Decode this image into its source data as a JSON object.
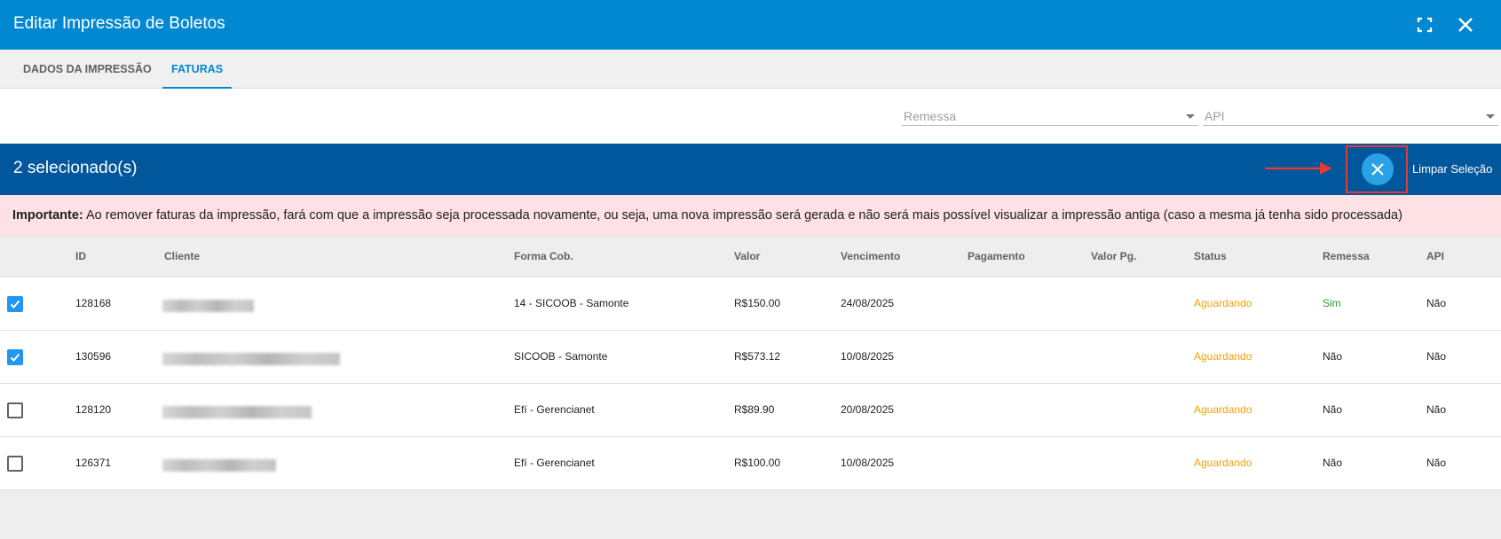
{
  "dialog": {
    "title": "Editar Impressão de Boletos"
  },
  "titlebar_icons": {
    "fullscreen": "fullscreen-icon",
    "close": "close-icon"
  },
  "tabs": [
    {
      "label": "DADOS DA IMPRESSÃO",
      "active": false
    },
    {
      "label": "FATURAS",
      "active": true
    }
  ],
  "filters": {
    "remessa_placeholder": "Remessa",
    "api_placeholder": "API"
  },
  "selection": {
    "count_label": "2 selecionado(s)",
    "clear_label": "Limpar Seleção"
  },
  "warning": {
    "strong": "Importante:",
    "text": " Ao remover faturas da impressão, fará com que a impressão seja processada novamente, ou seja, uma nova impressão será gerada e não será mais possível visualizar a impressão antiga (caso a mesma já tenha sido processada)"
  },
  "table": {
    "headers": {
      "id": "ID",
      "cliente": "Cliente",
      "forma": "Forma Cob.",
      "valor": "Valor",
      "vencimento": "Vencimento",
      "pagamento": "Pagamento",
      "valor_pg": "Valor Pg.",
      "status": "Status",
      "remessa": "Remessa",
      "api": "API"
    },
    "rows": [
      {
        "checked": true,
        "id": "128168",
        "forma": "14 - SICOOB - Samonte",
        "valor": "R$150.00",
        "vencimento": "24/08/2025",
        "pagamento": "",
        "valor_pg": "",
        "status": "Aguardando",
        "remessa": "Sim",
        "api": "Não"
      },
      {
        "checked": true,
        "id": "130596",
        "forma": "SICOOB - Samonte",
        "valor": "R$573.12",
        "vencimento": "10/08/2025",
        "pagamento": "",
        "valor_pg": "",
        "status": "Aguardando",
        "remessa": "Não",
        "api": "Não"
      },
      {
        "checked": false,
        "id": "128120",
        "forma": "Efí - Gerencianet",
        "valor": "R$89.90",
        "vencimento": "20/08/2025",
        "pagamento": "",
        "valor_pg": "",
        "status": "Aguardando",
        "remessa": "Não",
        "api": "Não"
      },
      {
        "checked": false,
        "id": "126371",
        "forma": "Efí - Gerencianet",
        "valor": "R$100.00",
        "vencimento": "10/08/2025",
        "pagamento": "",
        "valor_pg": "",
        "status": "Aguardando",
        "remessa": "Não",
        "api": "Não"
      }
    ]
  },
  "colors": {
    "titlebar": "#0288d1",
    "selection_bar": "#01579b",
    "warning_bg": "#fde1e4",
    "status_pending": "#f5a000",
    "remessa_yes": "#2e9b2e",
    "highlight_box": "#e53935"
  }
}
